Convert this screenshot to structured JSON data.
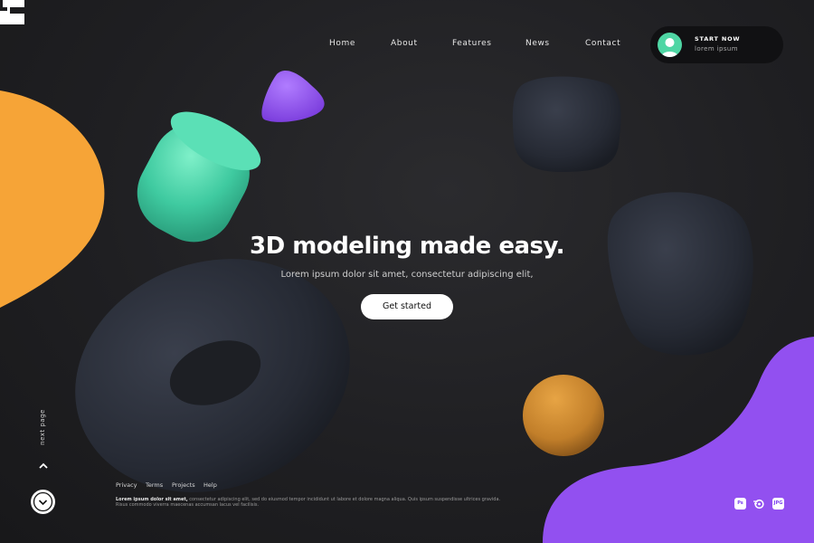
{
  "nav": {
    "items": [
      "Home",
      "About",
      "Features",
      "News",
      "Contact"
    ]
  },
  "cta": {
    "title": "START NOW",
    "subtitle": "lorem ipsum"
  },
  "hero": {
    "title": "3D modeling made easy.",
    "subtitle": "Lorem ipsum dolor sit amet, consectetur adipiscing elit,",
    "button": "Get started"
  },
  "side": {
    "next_page": "next page"
  },
  "footer": {
    "links": [
      "Privacy",
      "Terms",
      "Projects",
      "Help"
    ],
    "fine_bold": "Lorem ipsum dolor sit amet,",
    "fine_rest": " consectetur adipiscing elit, sed do eiusmod tempor incididunt ut labore et dolore magna aliqua. Quis ipsum suspendisse ultrices gravida. Risus commodo viverra maecenas accumsan lacus vel facilisis.",
    "badges": [
      "Ps",
      "",
      "JPG"
    ]
  },
  "colors": {
    "orange_blob": "#f6a437",
    "purple_blob": "#9250f0",
    "green": "#44d0a6",
    "violet": "#8c4ee6",
    "sphere": "#d28a30"
  },
  "icons": [
    "logo-icon",
    "avatar-icon",
    "chevron-up-icon",
    "chevron-down-icon",
    "photoshop-icon",
    "blender-icon",
    "jpg-icon"
  ]
}
